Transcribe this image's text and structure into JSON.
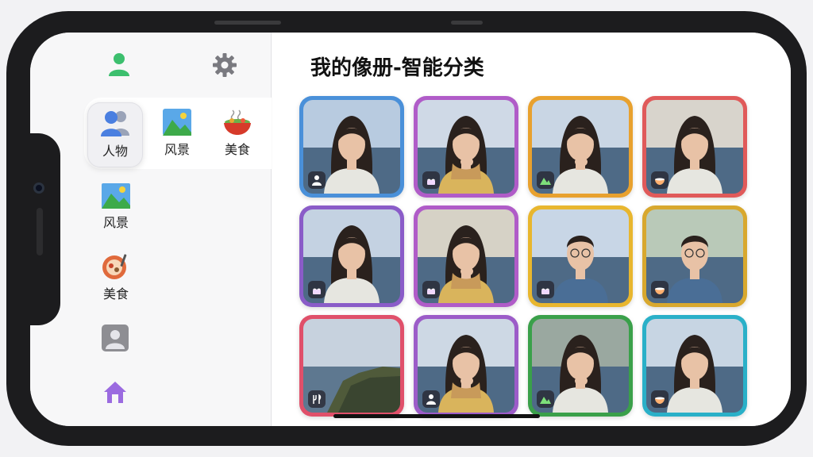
{
  "page": {
    "title": "我的像册-智能分类"
  },
  "sidebar": {
    "tabs": [
      {
        "label": "人物",
        "icon": "people-icon",
        "active": true
      },
      {
        "label": "风景",
        "icon": "landscape-icon",
        "active": false
      },
      {
        "label": "美食",
        "icon": "food-bowl-icon",
        "active": false
      }
    ],
    "items": [
      {
        "label": "风景",
        "icon": "landscape-icon"
      },
      {
        "label": "美食",
        "icon": "food-plate-icon"
      }
    ]
  },
  "photos": [
    {
      "subject": "woman-long-hair",
      "border": "#4a90d9",
      "badge_icon": "person-icon"
    },
    {
      "subject": "woman-scarf",
      "border": "#b05cc8",
      "badge_icon": "cake-icon"
    },
    {
      "subject": "woman-hand-chin",
      "border": "#e8a12e",
      "badge_icon": "mountain-icon"
    },
    {
      "subject": "woman-glasses-on-head",
      "border": "#e05a5a",
      "badge_icon": "bowl-icon"
    },
    {
      "subject": "woman-sea",
      "border": "#8a5cc8",
      "badge_icon": "cake-icon"
    },
    {
      "subject": "woman-scarf",
      "border": "#b05cc8",
      "badge_icon": "cake-icon"
    },
    {
      "subject": "man-glasses",
      "border": "#e8b62e",
      "badge_icon": "cake-icon"
    },
    {
      "subject": "man-glasses",
      "border": "#d8a82e",
      "badge_icon": "bowl-icon"
    },
    {
      "subject": "coastline",
      "border": "#e0506a",
      "badge_icon": "food-icon"
    },
    {
      "subject": "woman-scarf",
      "border": "#9c5cc8",
      "badge_icon": "person-icon"
    },
    {
      "subject": "woman-hand-chin",
      "border": "#3aa04a",
      "badge_icon": "mountain-icon"
    },
    {
      "subject": "woman-sea",
      "border": "#2ab0c8",
      "badge_icon": "bowl-icon"
    }
  ]
}
